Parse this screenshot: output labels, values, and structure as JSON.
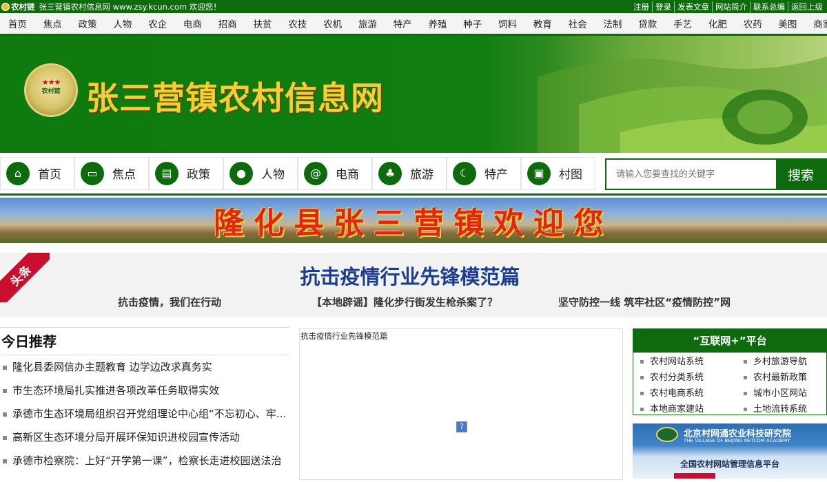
{
  "topbar": {
    "brand": "农村链",
    "welcome": "张三营镇农村信息网 www.zsy.kcun.com 欢迎您！",
    "links": [
      "注册",
      "登录",
      "发表文章",
      "网站简介",
      "联系总编",
      "返回上级"
    ]
  },
  "channels": [
    "首页",
    "焦点",
    "政策",
    "人物",
    "农企",
    "电商",
    "招商",
    "扶贫",
    "农技",
    "农机",
    "旅游",
    "特产",
    "养殖",
    "种子",
    "饲料",
    "教育",
    "社会",
    "法制",
    "贷款",
    "手艺",
    "化肥",
    "农药",
    "美图",
    "商家"
  ],
  "banner": {
    "logo_text": "农村链",
    "title": "张三营镇农村信息网"
  },
  "icon_nav": [
    {
      "label": "首页",
      "icon": "home-icon",
      "glyph": "⌂"
    },
    {
      "label": "焦点",
      "icon": "tv-icon",
      "glyph": "▭"
    },
    {
      "label": "政策",
      "icon": "document-icon",
      "glyph": "▤"
    },
    {
      "label": "人物",
      "icon": "person-icon",
      "glyph": "●"
    },
    {
      "label": "电商",
      "icon": "at-icon",
      "glyph": "@"
    },
    {
      "label": "旅游",
      "icon": "palm-tree-icon",
      "glyph": "♣"
    },
    {
      "label": "特产",
      "icon": "banana-icon",
      "glyph": "☾"
    },
    {
      "label": "村图",
      "icon": "image-icon",
      "glyph": "▣"
    }
  ],
  "search": {
    "placeholder": "请输入您要查找的关键字",
    "button": "搜索"
  },
  "welcome_banner": "隆化县张三营镇欢迎您",
  "headline": {
    "ribbon": "头条",
    "title": "抗击疫情行业先锋模范篇",
    "subs": [
      "抗击疫情，我们在行动",
      "【本地辟谣】隆化步行街发生枪杀案了？",
      "坚守防控一线 筑牢社区“疫情防控”网"
    ]
  },
  "recommend": {
    "title": "今日推荐",
    "items": [
      "隆化县委网信办主题教育 边学边改求真务实",
      "市生态环境局扎实推进各项改革任务取得实效",
      "承德市生态环境局组织召开党组理论中心组“不忘初心、牢记使命”专题学习",
      "高新区生态环境分局开展环保知识进校园宣传活动",
      "承德市检察院：上好“开学第一课”，检察长走进校园送法治"
    ]
  },
  "video": {
    "caption": "抗击疫情行业先锋模范篇",
    "broken_image": "?"
  },
  "internet_plus": {
    "title": "“互联网+”平台",
    "links": [
      "农村网站系统",
      "乡村旅游导航",
      "农村分类系统",
      "农村最新政策",
      "农村电商系统",
      "城市小区网站",
      "本地商家建站",
      "土地流转系统"
    ]
  },
  "academy": {
    "title": "北京村网通农业科技研究院",
    "subtitle": "THE VILLAGE OF BEIJING NETCOM ACADEMY",
    "platform": "全国农村网站管理信息平台"
  },
  "colors": {
    "brand_green": "#0d6b0d",
    "title_gold": "#f1cf35",
    "headline_blue": "#1c3d8f",
    "ribbon_red": "#c8102e"
  }
}
